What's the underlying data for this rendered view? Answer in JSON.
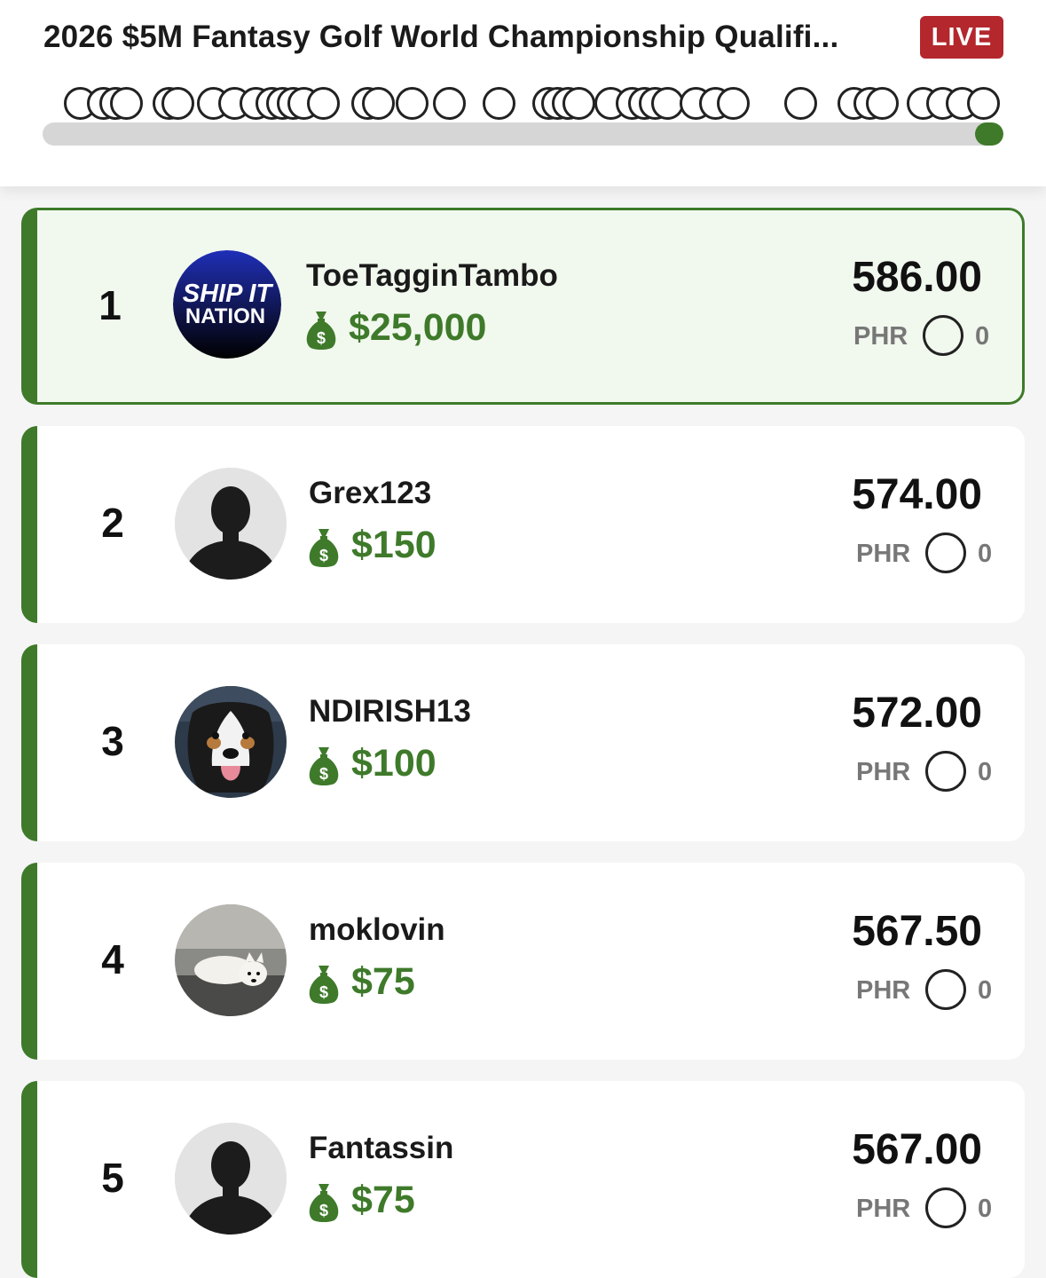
{
  "header": {
    "title": "2026 $5M Fantasy Golf World Championship Qualifi...",
    "live_label": "LIVE",
    "progress_fraction": 0.97
  },
  "colors": {
    "accent_green": "#3e7a2a",
    "live_red": "#b3272d",
    "leader_bg": "#f1f8ee"
  },
  "leaderboard": [
    {
      "rank": "1",
      "username": "ToeTagginTambo",
      "prize": "$25,000",
      "score": "586.00",
      "phr_label": "PHR",
      "phr_value": "0",
      "avatar": "ship-it-nation-logo",
      "avatar_text_1": "SHIP IT",
      "avatar_text_2": "NATION"
    },
    {
      "rank": "2",
      "username": "Grex123",
      "prize": "$150",
      "score": "574.00",
      "phr_label": "PHR",
      "phr_value": "0",
      "avatar": "default-silhouette"
    },
    {
      "rank": "3",
      "username": "NDIRISH13",
      "prize": "$100",
      "score": "572.00",
      "phr_label": "PHR",
      "phr_value": "0",
      "avatar": "dog-photo"
    },
    {
      "rank": "4",
      "username": "moklovin",
      "prize": "$75",
      "score": "567.50",
      "phr_label": "PHR",
      "phr_value": "0",
      "avatar": "puppy-photo"
    },
    {
      "rank": "5",
      "username": "Fantassin",
      "prize": "$75",
      "score": "567.00",
      "phr_label": "PHR",
      "phr_value": "0",
      "avatar": "default-silhouette"
    }
  ]
}
